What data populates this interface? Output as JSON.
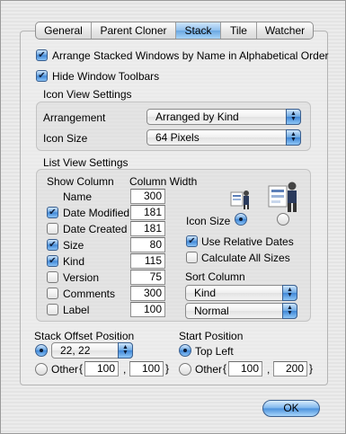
{
  "tabs": [
    {
      "label": "General",
      "selected": false
    },
    {
      "label": "Parent Cloner",
      "selected": false
    },
    {
      "label": "Stack",
      "selected": true
    },
    {
      "label": "Tile",
      "selected": false
    },
    {
      "label": "Watcher",
      "selected": false
    }
  ],
  "options": {
    "arrange_alpha": "Arrange Stacked Windows by Name in Alphabetical Order",
    "hide_toolbars": "Hide Window Toolbars"
  },
  "icon_view": {
    "title": "Icon View Settings",
    "arrangement_label": "Arrangement",
    "arrangement_value": "Arranged by Kind",
    "icon_size_label": "Icon Size",
    "icon_size_value": "64 Pixels"
  },
  "list_view": {
    "title": "List View Settings",
    "col_header_show": "Show Column",
    "col_header_width": "Column Width",
    "columns": [
      {
        "name": "Name",
        "width": "300",
        "checkbox": false,
        "checked": false
      },
      {
        "name": "Date Modified",
        "width": "181",
        "checkbox": true,
        "checked": true
      },
      {
        "name": "Date Created",
        "width": "181",
        "checkbox": true,
        "checked": false
      },
      {
        "name": "Size",
        "width": "80",
        "checkbox": true,
        "checked": true
      },
      {
        "name": "Kind",
        "width": "115",
        "checkbox": true,
        "checked": true
      },
      {
        "name": "Version",
        "width": "75",
        "checkbox": true,
        "checked": false
      },
      {
        "name": "Comments",
        "width": "300",
        "checkbox": true,
        "checked": false
      },
      {
        "name": "Label",
        "width": "100",
        "checkbox": true,
        "checked": false
      }
    ],
    "icon_size_label": "Icon Size",
    "use_relative_dates": "Use Relative Dates",
    "calculate_all_sizes": "Calculate All Sizes",
    "sort_column_label": "Sort Column",
    "sort_column_value": "Kind",
    "sort_order_value": "Normal"
  },
  "stack_offset": {
    "title": "Stack Offset Position",
    "preset_value": "22, 22",
    "other_label": "Other",
    "other_x": "100",
    "other_y": "100",
    "brace_open": "{",
    "brace_close": "}",
    "comma": ","
  },
  "start_position": {
    "title": "Start Position",
    "top_left_label": "Top Left",
    "other_label": "Other",
    "other_x": "100",
    "other_y": "200",
    "brace_open": "{",
    "brace_close": "}",
    "comma": ","
  },
  "ok_label": "OK",
  "colors": {
    "accent": "#5f9fe0",
    "window_bg": "#ececec"
  }
}
